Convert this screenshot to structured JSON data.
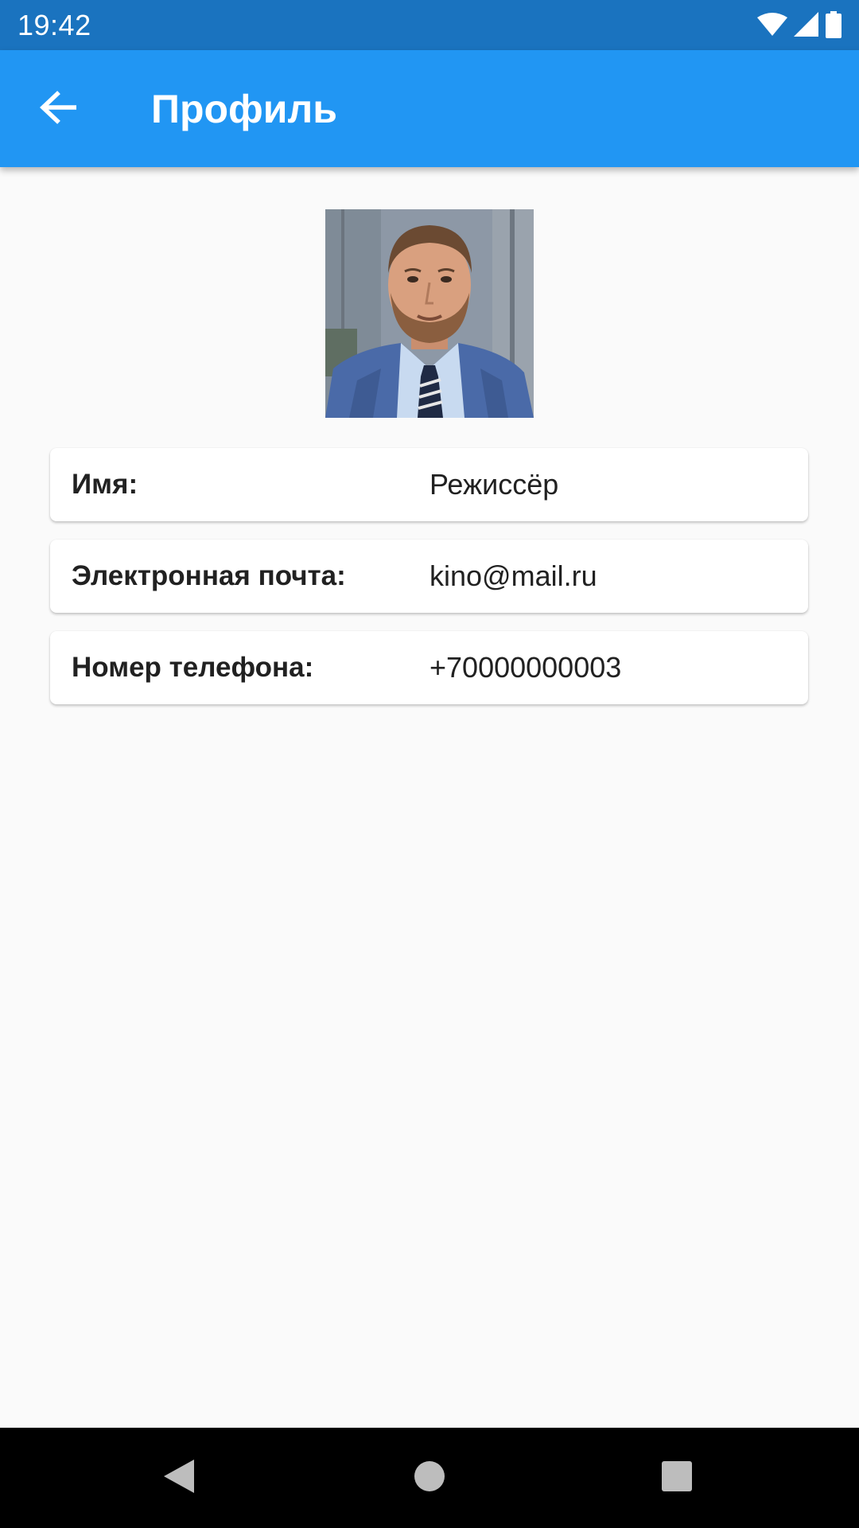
{
  "status_bar": {
    "time": "19:42",
    "icons": [
      "wifi-icon",
      "signal-icon",
      "battery-icon"
    ]
  },
  "app_bar": {
    "back_icon": "arrow-back-icon",
    "title": "Профиль",
    "color": "#2196f3"
  },
  "profile": {
    "avatar_icon": "profile-photo",
    "fields": [
      {
        "label": "Имя:",
        "value": "Режиссёр"
      },
      {
        "label": "Электронная почта:",
        "value": "kino@mail.ru"
      },
      {
        "label": "Номер телефона:",
        "value": "+70000000003"
      }
    ]
  },
  "nav_bar": {
    "icons": [
      "nav-back-icon",
      "nav-home-icon",
      "nav-recents-icon"
    ]
  },
  "colors": {
    "status_bar": "#1a73bf",
    "accent": "#2196f3",
    "background": "#fafafa",
    "card": "#ffffff",
    "text": "#212121"
  }
}
